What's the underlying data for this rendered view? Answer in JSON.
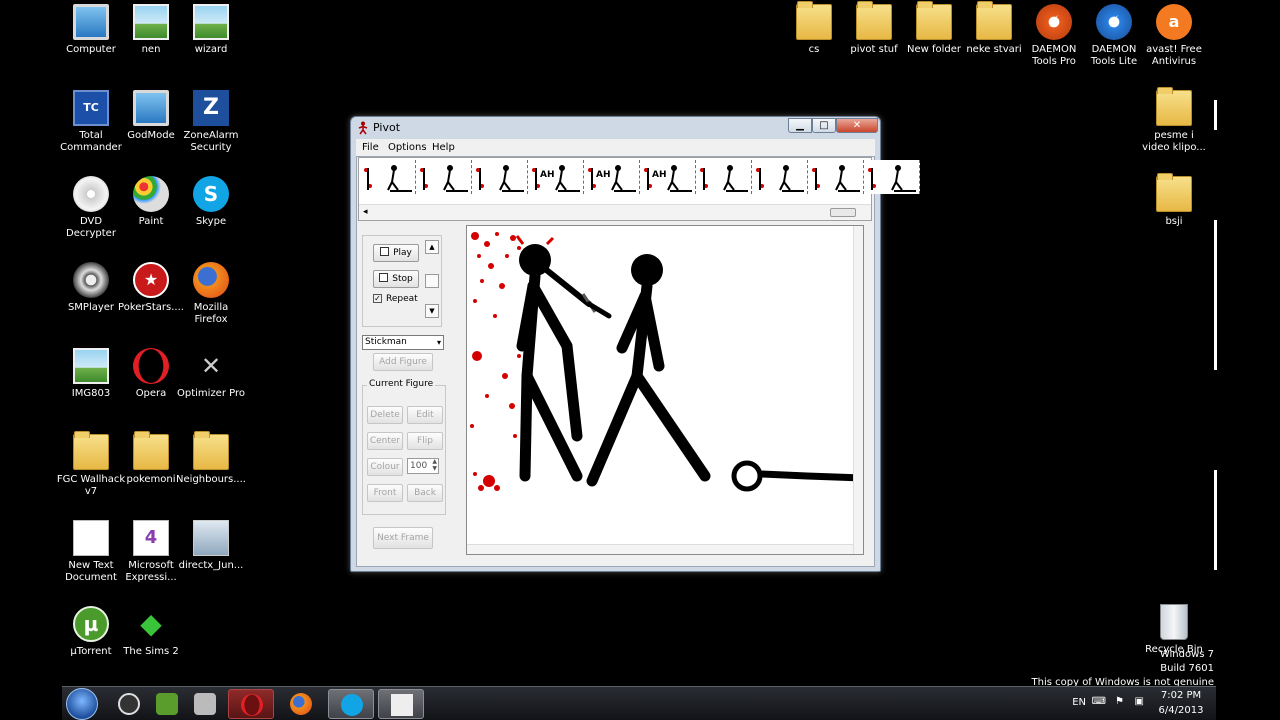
{
  "desktop": {
    "icons_left": [
      {
        "label": "Computer"
      },
      {
        "label": "nen"
      },
      {
        "label": "wizard"
      },
      {
        "label": "Total Commander"
      },
      {
        "label": "GodMode"
      },
      {
        "label": "ZoneAlarm Security"
      },
      {
        "label": "DVD Decrypter"
      },
      {
        "label": "Paint"
      },
      {
        "label": "Skype"
      },
      {
        "label": "SMPlayer"
      },
      {
        "label": "PokerStars...."
      },
      {
        "label": "Mozilla Firefox"
      },
      {
        "label": "IMG803"
      },
      {
        "label": "Opera"
      },
      {
        "label": "Optimizer Pro"
      },
      {
        "label": "FGC Wallhack v7"
      },
      {
        "label": "pokemoni"
      },
      {
        "label": "Neighbours...."
      },
      {
        "label": "New Text Document"
      },
      {
        "label": "Microsoft Expressi..."
      },
      {
        "label": "directx_Jun..."
      },
      {
        "label": "µTorrent"
      },
      {
        "label": "The Sims 2"
      }
    ],
    "icons_top": [
      {
        "label": "cs"
      },
      {
        "label": "pivot stuf"
      },
      {
        "label": "New folder"
      },
      {
        "label": "neke stvari"
      },
      {
        "label": "DAEMON Tools Pro"
      },
      {
        "label": "DAEMON Tools Lite"
      },
      {
        "label": "avast! Free Antivirus"
      }
    ],
    "icons_right": [
      {
        "label": "pesme i video klipo..."
      },
      {
        "label": "bsji"
      },
      {
        "label": "Recycle Bin"
      }
    ]
  },
  "window": {
    "title": "Pivot",
    "menu": [
      "File",
      "Options",
      "Help"
    ],
    "controls": {
      "play": "Play",
      "stop": "Stop",
      "repeat": "Repeat",
      "figure_select": "Stickman",
      "add_figure": "Add Figure",
      "group_title": "Current Figure",
      "delete": "Delete",
      "edit": "Edit",
      "center": "Center",
      "flip": "Flip",
      "colour": "Colour",
      "zoom_value": "100",
      "front": "Front",
      "back": "Back",
      "next_frame": "Next Frame"
    },
    "frame_thumbs": [
      "",
      "",
      "",
      "AH",
      "AH",
      "AH",
      "",
      "",
      "",
      ""
    ]
  },
  "watermark": {
    "line1": "Windows 7",
    "line2": "Build 7601",
    "line3": "This copy of Windows is not genuine"
  },
  "taskbar": {
    "lang": "EN",
    "time": "7:02 PM",
    "date": "6/4/2013"
  },
  "colors": {
    "blood": "#d40000",
    "taskbar": "#1b1c20"
  }
}
